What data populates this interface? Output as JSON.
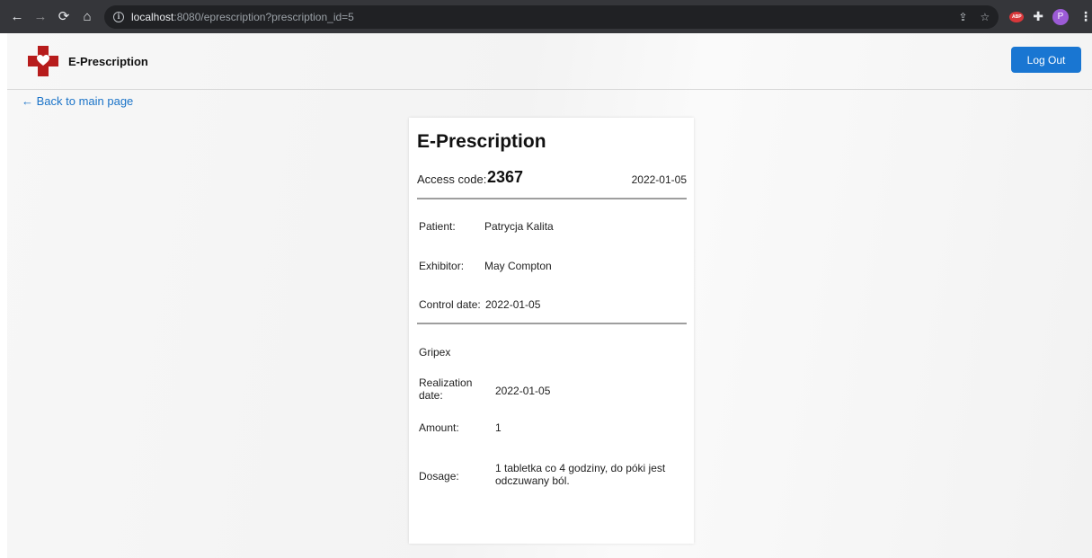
{
  "browser": {
    "url_host": "localhost",
    "url_rest": ":8080/eprescription?prescription_id=5",
    "profile_initial": "P",
    "abp_label": "ABP"
  },
  "header": {
    "brand": "E-Prescription",
    "logout_label": "Log Out"
  },
  "nav": {
    "back_label": "← Back to main page"
  },
  "prescription": {
    "title": "E-Prescription",
    "access_label": "Access code:",
    "access_code": "2367",
    "issue_date": "2022-01-05",
    "patient_label": "Patient:",
    "patient": "Patrycja Kalita",
    "exhibitor_label": "Exhibitor:",
    "exhibitor": "May Compton",
    "control_label": "Control date:",
    "control_date": "2022-01-05"
  },
  "medicine": {
    "name": "Gripex",
    "realization_label_1": "Realization",
    "realization_label_2": "date:",
    "realization_date": "2022-01-05",
    "amount_label": "Amount:",
    "amount": "1",
    "dosage_label": "Dosage:",
    "dosage_line_1": "1 tabletka co 4 godziny, do póki jest",
    "dosage_line_2": "odczuwany ból."
  },
  "colors": {
    "accent": "#1976d2",
    "logo_red": "#b71c1c",
    "link": "#1a73c8"
  }
}
